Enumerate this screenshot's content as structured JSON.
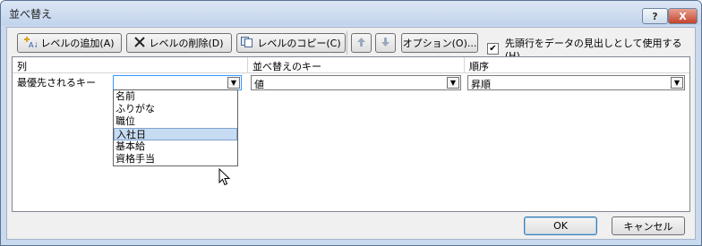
{
  "window": {
    "title": "並べ替え",
    "help_label": "?",
    "close_label": "X"
  },
  "toolbar": {
    "add_level": "レベルの追加(A)",
    "delete_level": "レベルの削除(D)",
    "copy_level": "レベルのコピー(C)",
    "move_up_icon": "arrow-up",
    "move_down_icon": "arrow-down",
    "options": "オプション(O)...",
    "header_checkbox_label": "先頭行をデータの見出しとして使用する(H)",
    "header_checkbox_checked": true
  },
  "grid": {
    "headers": [
      "列",
      "並べ替えのキー",
      "順序"
    ],
    "row": {
      "label": "最優先されるキー",
      "column_value": "",
      "key_value": "値",
      "order_value": "昇順"
    },
    "dropdown_items": [
      "名前",
      "ふりがな",
      "職位",
      "入社日",
      "基本給",
      "資格手当"
    ],
    "dropdown_selected_index": 3
  },
  "footer": {
    "ok": "OK",
    "cancel": "キャンセル"
  }
}
